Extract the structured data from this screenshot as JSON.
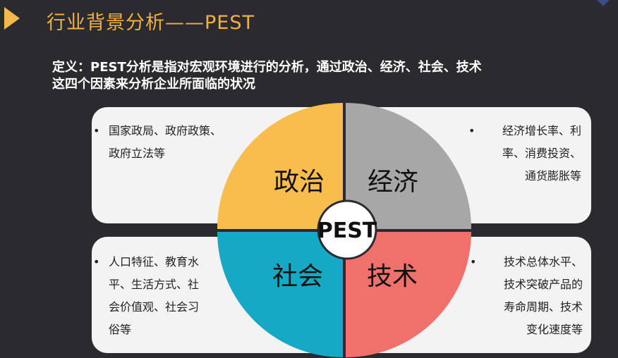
{
  "title": "行业背景分析——PEST",
  "definition": {
    "line1": "定义：PEST分析是指对宏观环境进行的分析，通过政治、经济、社会、技术",
    "line2": "这四个因素来分析企业所面临的状况"
  },
  "center_label": "PEST",
  "quadrants": {
    "political": {
      "label": "政治",
      "color": "#f9bd4d",
      "bullet": [
        "国家政局、政府政策、",
        "政府立法等"
      ]
    },
    "economic": {
      "label": "经济",
      "color": "#a7a7a7",
      "bullet": [
        "经济增长率、利",
        "率、消费投资、",
        "通货膨胀等"
      ]
    },
    "social": {
      "label": "社会",
      "color": "#16a9c5",
      "bullet": [
        "人口特征、教育水",
        "平、生活方式、社",
        "会价值观、社会习",
        "俗等"
      ]
    },
    "technological": {
      "label": "技术",
      "color": "#f0706b",
      "bullet": [
        "技术总体水平、",
        "技术突破产品的",
        "寿命周期、技术",
        "变化速度等"
      ]
    }
  },
  "colors": {
    "background": "#2b2b2f",
    "title": "#f2b13c",
    "card": "#f3f3f3"
  }
}
